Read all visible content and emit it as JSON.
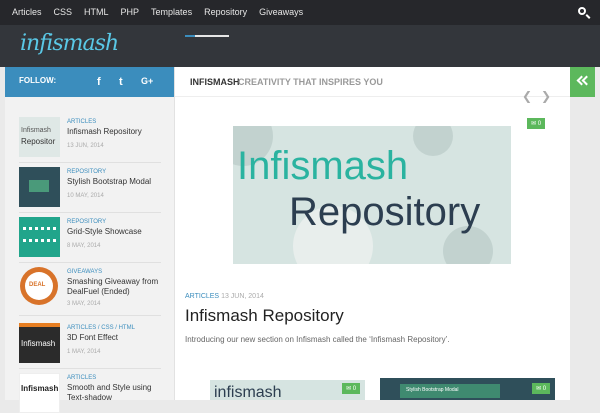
{
  "nav": {
    "items": [
      "Articles",
      "CSS",
      "HTML",
      "PHP",
      "Templates",
      "Repository",
      "Giveaways"
    ]
  },
  "logo": {
    "text": "infismash"
  },
  "sidebar": {
    "follow_label": "FOLLOW:",
    "social": [
      "f",
      "t",
      "G+"
    ],
    "posts": [
      {
        "category": "ARTICLES",
        "title": "Infismash Repository",
        "date": "13 JUN, 2014"
      },
      {
        "category": "REPOSITORY",
        "title": "Stylish Bootstrap Modal",
        "date": "10 MAY, 2014"
      },
      {
        "category": "REPOSITORY",
        "title": "Grid-Style Showcase",
        "date": "8 MAY, 2014"
      },
      {
        "category": "GIVEAWAYS",
        "title": "Smashing Giveaway from DealFuel (Ended)",
        "date": "3 MAY, 2014"
      },
      {
        "category": "ARTICLES / CSS / HTML",
        "title": "3D Font Effect",
        "date": "1 MAY, 2014"
      },
      {
        "category": "ARTICLES",
        "title": "Smooth and Style using Text-shadow",
        "date": ""
      }
    ]
  },
  "main": {
    "site_name": "INFISMASH",
    "tagline": "CREATIVITY THAT INSPIRES YOU",
    "featured": {
      "image_word1": "Infismash",
      "image_word2": "Repository",
      "comments": "0"
    },
    "post": {
      "category": "ARTICLES",
      "date": "13 JUN, 2014",
      "title": "Infismash Repository",
      "excerpt": "Introducing our new section on Infismash called the ‘Infismash Repository’."
    },
    "cards": [
      {
        "comments": "0",
        "image_text": "infismash"
      },
      {
        "comments": "0",
        "image_text": "Stylish Bootstrap Modal"
      }
    ]
  },
  "colors": {
    "accent": "#3b8dbd",
    "green": "#5cb85c",
    "dark": "#26272b"
  }
}
